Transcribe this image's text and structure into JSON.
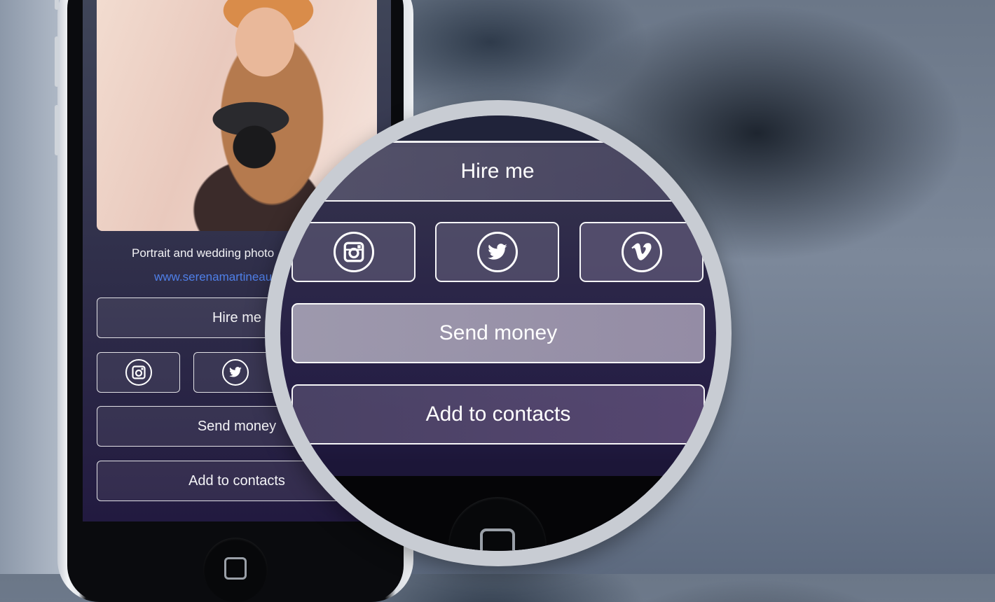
{
  "profile": {
    "tagline": "Portrait and wedding photo",
    "website": "www.serenamartineau"
  },
  "actions": {
    "hire_label": "Hire me",
    "send_money_label": "Send money",
    "add_contacts_label": "Add to contacts"
  },
  "social": [
    "instagram-icon",
    "twitter-icon",
    "vimeo-icon"
  ],
  "colors": {
    "link": "#4f7fe8",
    "screen_top": "#3f4558",
    "screen_bottom": "#221a40"
  }
}
